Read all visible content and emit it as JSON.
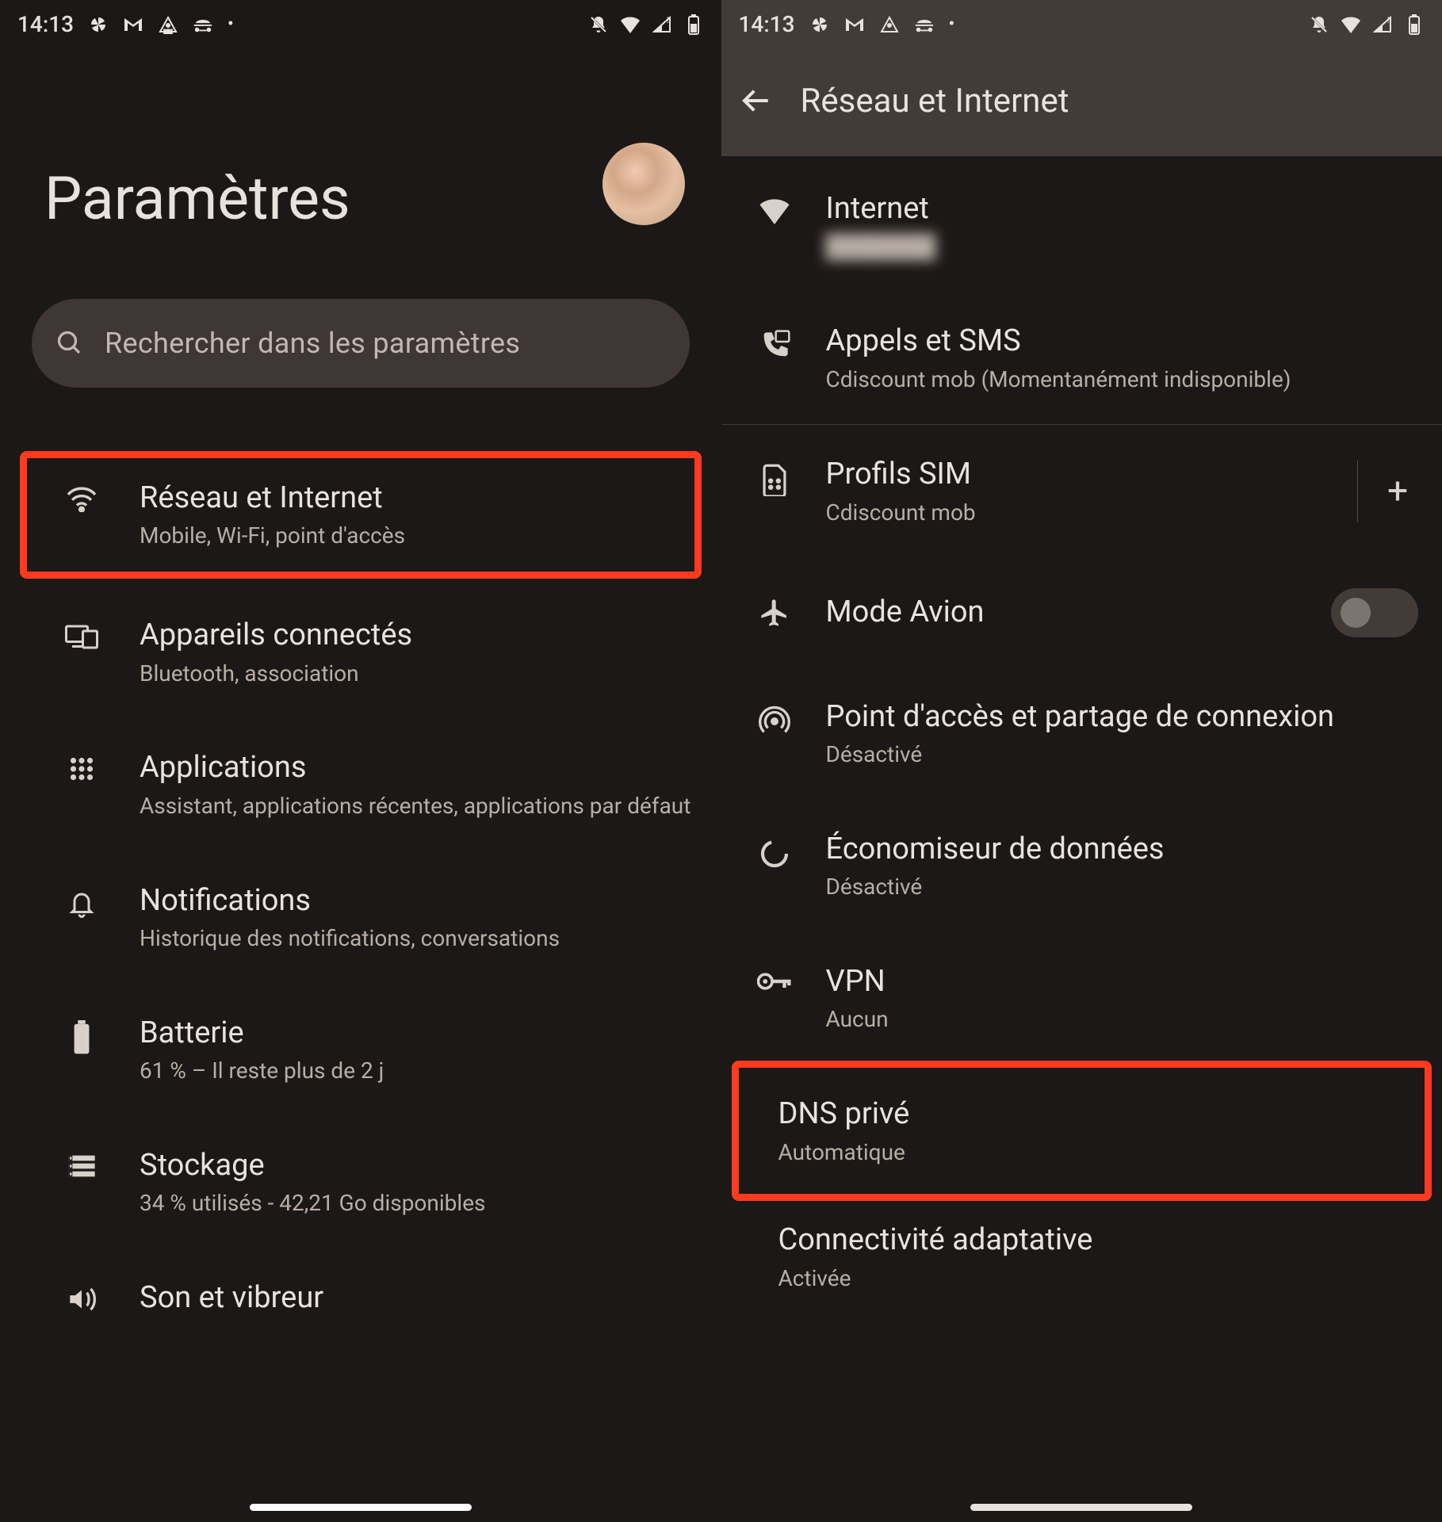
{
  "status": {
    "time": "14:13"
  },
  "left": {
    "title": "Paramètres",
    "search_placeholder": "Rechercher dans les paramètres",
    "items": [
      {
        "title": "Réseau et Internet",
        "subtitle": "Mobile, Wi-Fi, point d'accès"
      },
      {
        "title": "Appareils connectés",
        "subtitle": "Bluetooth, association"
      },
      {
        "title": "Applications",
        "subtitle": "Assistant, applications récentes, applications par défaut"
      },
      {
        "title": "Notifications",
        "subtitle": "Historique des notifications, conversations"
      },
      {
        "title": "Batterie",
        "subtitle": "61 % – Il reste plus de 2 j"
      },
      {
        "title": "Stockage",
        "subtitle": "34 % utilisés - 42,21 Go disponibles"
      },
      {
        "title": "Son et vibreur",
        "subtitle": ""
      }
    ]
  },
  "right": {
    "header": "Réseau et Internet",
    "items": {
      "internet": {
        "title": "Internet",
        "subtitle": "███████"
      },
      "calls": {
        "title": "Appels et SMS",
        "subtitle": "Cdiscount mob (Momentanément indisponible)"
      },
      "sim": {
        "title": "Profils SIM",
        "subtitle": "Cdiscount mob"
      },
      "airplane": {
        "title": "Mode Avion"
      },
      "hotspot": {
        "title": "Point d'accès et partage de connexion",
        "subtitle": "Désactivé"
      },
      "datasaver": {
        "title": "Économiseur de données",
        "subtitle": "Désactivé"
      },
      "vpn": {
        "title": "VPN",
        "subtitle": "Aucun"
      },
      "dns": {
        "title": "DNS privé",
        "subtitle": "Automatique"
      },
      "adaptive": {
        "title": "Connectivité adaptative",
        "subtitle": "Activée"
      }
    }
  }
}
